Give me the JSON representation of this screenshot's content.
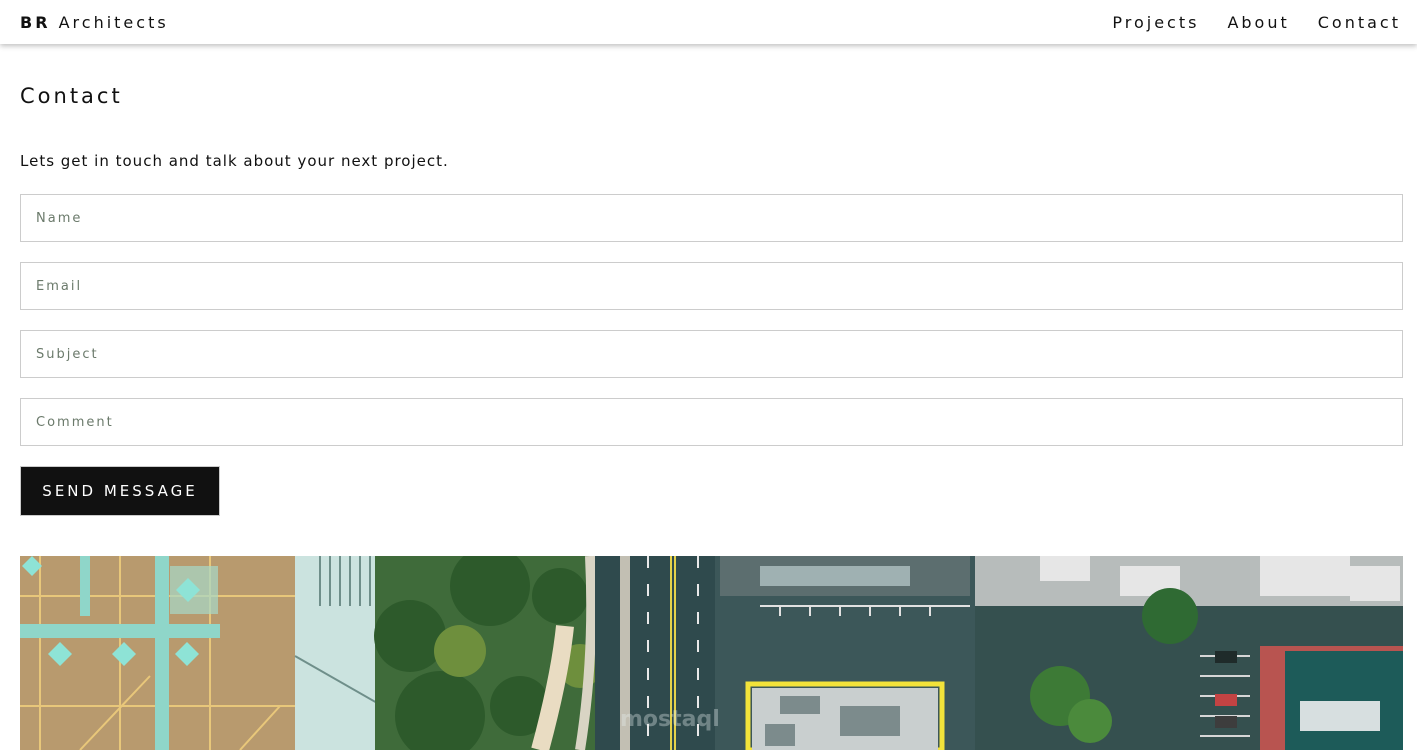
{
  "header": {
    "brand_bold": "BR",
    "brand_rest": " Architects",
    "nav": [
      {
        "label": "Projects"
      },
      {
        "label": "About"
      },
      {
        "label": "Contact"
      }
    ]
  },
  "contact": {
    "title": "Contact",
    "intro": "Lets get in touch and talk about your next project.",
    "fields": {
      "name_placeholder": "Name",
      "email_placeholder": "Email",
      "subject_placeholder": "Subject",
      "comment_placeholder": "Comment"
    },
    "send_label": "SEND MESSAGE"
  },
  "hero_image": {
    "description_icon": "aerial-city-photo",
    "watermark_text": "mostaql"
  },
  "colors": {
    "button_bg": "#111111",
    "field_border": "#cccccc",
    "placeholder": "#6b7a6b"
  }
}
